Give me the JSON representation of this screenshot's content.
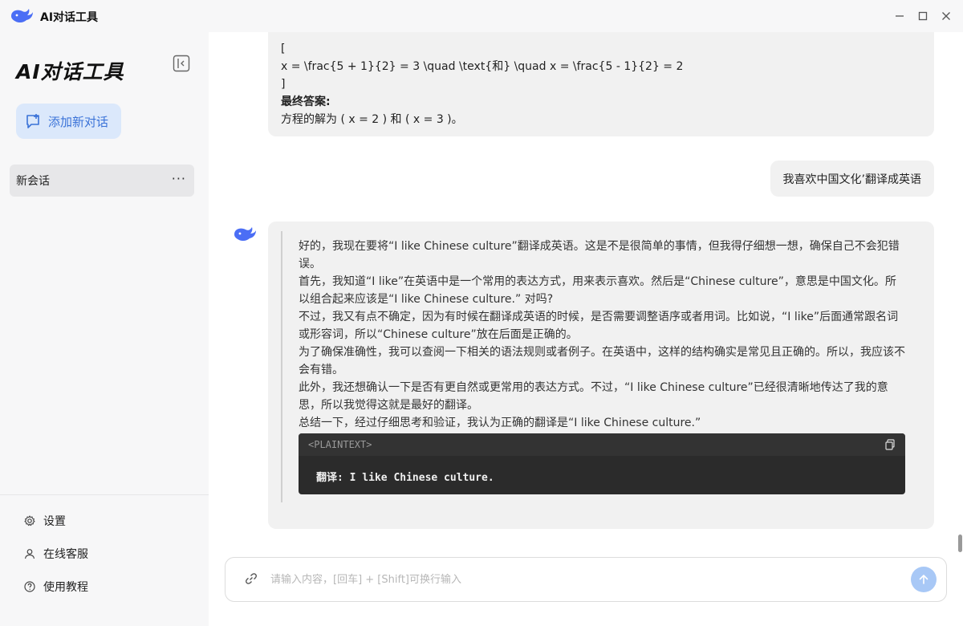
{
  "titlebar": {
    "app_title": "AI对话工具",
    "controls": {
      "minimize": "minimize-icon",
      "maximize": "maximize-icon",
      "close": "close-icon"
    }
  },
  "sidebar": {
    "brand": "AI对话工具",
    "new_chat_label": "添加新对话",
    "conversations": [
      {
        "title": "新会话",
        "more": "···"
      }
    ],
    "footer": {
      "settings": "设置",
      "support": "在线客服",
      "tutorial": "使用教程"
    }
  },
  "chat": {
    "prev_answer_lines": [
      "[",
      "x = \\frac{5 + 1}{2} = 3 \\quad \\text{和} \\quad x = \\frac{5 - 1}{2} = 2",
      "]"
    ],
    "prev_answer_final_label": "最终答案:",
    "prev_answer_final": "方程的解为 ( x = 2 ) 和 ( x = 3 )。",
    "user_message": "我喜欢中国文化’翻译成英语",
    "assistant_think_lines": [
      "好的，我现在要将“I like Chinese culture”翻译成英语。这是不是很简单的事情，但我得仔细想一想，确保自己不会犯错误。",
      "首先，我知道“I like”在英语中是一个常用的表达方式，用来表示喜欢。然后是“Chinese culture”，意思是中国文化。所以组合起来应该是“I like Chinese culture.” 对吗?",
      "不过，我又有点不确定，因为有时候在翻译成英语的时候，是否需要调整语序或者用词。比如说，“I like”后面通常跟名词或形容词，所以“Chinese culture”放在后面是正确的。",
      "为了确保准确性，我可以查阅一下相关的语法规则或者例子。在英语中，这样的结构确实是常见且正确的。所以，我应该不会有错。",
      "此外，我还想确认一下是否有更自然或更常用的表达方式。不过，“I like Chinese culture”已经很清晰地传达了我的意思，所以我觉得这就是最好的翻译。",
      "总结一下，经过仔细思考和验证，我认为正确的翻译是“I like Chinese culture.”"
    ],
    "code_lang": "<PLAINTEXT>",
    "code_content": "翻译: I like Chinese culture."
  },
  "input": {
    "placeholder": "请输入内容，[回车] + [Shift]可换行输入",
    "value": ""
  },
  "colors": {
    "accent": "#3b73d8",
    "new_chat_bg": "#dbe8fb",
    "send_btn": "#a8c8f6",
    "bubble_bg": "#f1f1f1",
    "sidebar_bg": "#f7f7f8",
    "code_bg": "#2b2b2b"
  }
}
